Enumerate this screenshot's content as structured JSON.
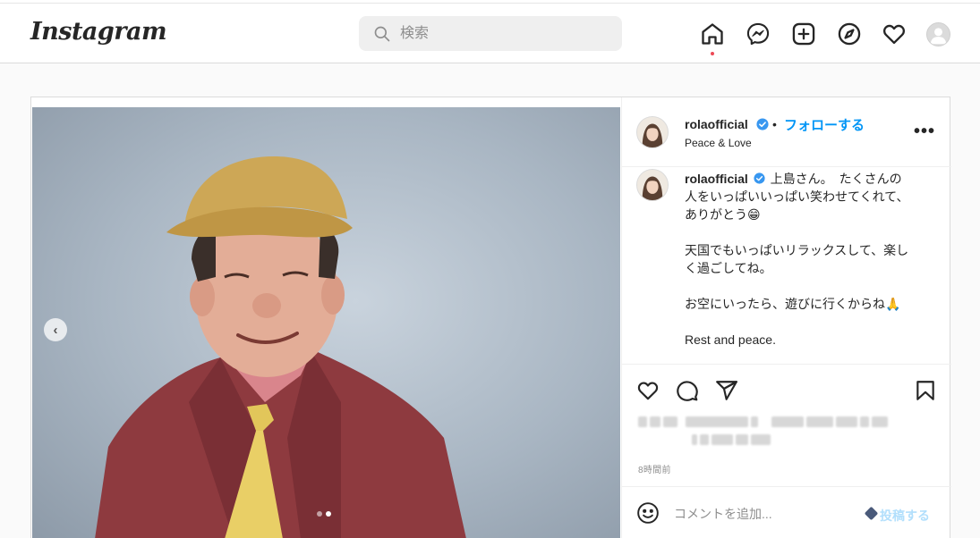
{
  "app": {
    "logo_text": "Instagram"
  },
  "search": {
    "placeholder": "検索"
  },
  "nav": {
    "icons": [
      "home-icon",
      "messenger-icon",
      "new-post-icon",
      "explore-icon",
      "activity-heart-icon",
      "profile-avatar"
    ],
    "active": "home",
    "active_dot_color": "#ed4956"
  },
  "post": {
    "author": {
      "username": "rolaofficial",
      "verified": true,
      "subtitle": "Peace & Love"
    },
    "follow_separator": "•",
    "follow_label": "フォローする",
    "more_label": "•••",
    "carousel": {
      "current_slide": 2,
      "total_slides": 2,
      "prev_label": "‹"
    },
    "caption": {
      "username": "rolaofficial",
      "lines": [
        "上島さん。　たくさんの",
        "人をいっぱいいっぱい笑わせてくれて、",
        "ありがとう😁",
        "",
        "天国でもいっぱいリラックスして、楽し",
        "く過ごしてね。",
        "",
        "お空にいったら、遊びに行くからね🙏",
        "",
        "Rest and peace."
      ]
    },
    "actions": [
      "heart-icon",
      "comment-icon",
      "share-icon",
      "bookmark-icon"
    ],
    "timestamp": "8時間前",
    "comment": {
      "placeholder": "コメントを追加...",
      "post_label": "投稿する"
    }
  },
  "colors": {
    "accent": "#0095f6",
    "post_disabled": "#b2dffc",
    "border": "#dbdbdb",
    "background": "#fafafa"
  }
}
